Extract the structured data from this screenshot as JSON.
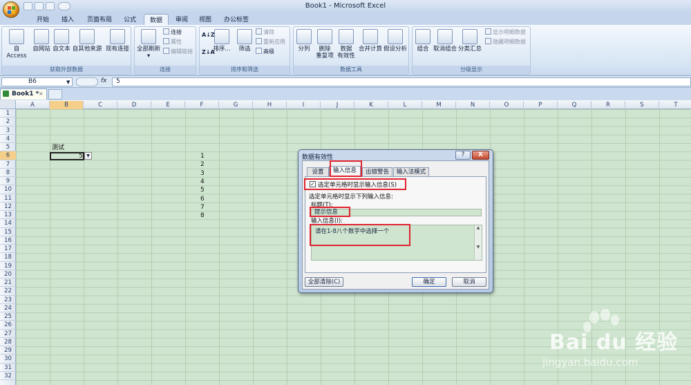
{
  "window": {
    "title": "Book1 - Microsoft Excel"
  },
  "ribbon": {
    "tabs": [
      "开始",
      "插入",
      "页面布局",
      "公式",
      "数据",
      "审阅",
      "视图",
      "办公标签"
    ],
    "active_tab": "数据",
    "groups": {
      "external": {
        "label": "获取外部数据",
        "buttons": [
          "自 Access",
          "自网站",
          "自文本",
          "自其他来源",
          "现有连接"
        ]
      },
      "connections": {
        "label": "连接",
        "refresh_all": "全部刷新",
        "connect": "连接",
        "properties": "属性",
        "edit_links": "编辑链接"
      },
      "sort_filter": {
        "label": "排序和筛选",
        "sort": "排序...",
        "filter": "筛选",
        "clear": "清除",
        "reapply": "重新应用",
        "advanced": "高级"
      },
      "data_tools": {
        "label": "数据工具",
        "text_to_columns": "分列",
        "remove_dup_1": "删除",
        "remove_dup_2": "重复项",
        "validation_1": "数据",
        "validation_2": "有效性",
        "consolidate": "合并计算",
        "whatif": "假设分析"
      },
      "outline": {
        "label": "分级显示",
        "group": "组合",
        "ungroup": "取消组合",
        "subtotal": "分类汇总",
        "show_detail": "显示明细数据",
        "hide_detail": "隐藏明细数据"
      }
    }
  },
  "formula_bar": {
    "name_box": "B6",
    "fx": "fx",
    "value": "5"
  },
  "workbook_tab": {
    "label": "Book1 *",
    "close": "×"
  },
  "sheet": {
    "columns": [
      "A",
      "B",
      "C",
      "D",
      "E",
      "F",
      "G",
      "H",
      "I",
      "J",
      "K",
      "L",
      "M",
      "N",
      "O",
      "P",
      "Q",
      "R",
      "S",
      "T"
    ],
    "selected_column": "B",
    "rows": [
      "1",
      "2",
      "3",
      "4",
      "5",
      "6",
      "7",
      "8",
      "9",
      "10",
      "11",
      "12",
      "13",
      "14",
      "15",
      "16",
      "17",
      "18",
      "19",
      "20",
      "21",
      "22",
      "23",
      "24",
      "25",
      "26",
      "27",
      "28",
      "29",
      "30",
      "31",
      "32"
    ],
    "selected_row": "6",
    "cells": {
      "B5": "测试",
      "B6": "5",
      "F6": "1",
      "F7": "2",
      "F8": "3",
      "F9": "4",
      "F10": "5",
      "F11": "6",
      "F12": "7",
      "F13": "8"
    }
  },
  "dialog": {
    "title": "数据有效性",
    "help": "?",
    "close": "X",
    "tabs": [
      "设置",
      "输入信息",
      "出错警告",
      "输入法模式"
    ],
    "active_tab": "输入信息",
    "show_input_checkbox": {
      "label": "选定单元格时显示输入信息(S)",
      "checked": true,
      "mark": "✓"
    },
    "section_label": "选定单元格时显示下列输入信息:",
    "title_label": "标题(T):",
    "title_value": "提示信息",
    "message_label": "输入信息(I):",
    "message_value": "请在1-8八个数字中选择一个",
    "clear_all": "全部清除(C)",
    "ok": "确定",
    "cancel": "取消"
  },
  "watermark": {
    "brand": "Bai du 经验",
    "url": "jingyan.baidu.com"
  },
  "colors": {
    "grid_bg": "#cfe5cf",
    "highlight": "#e0222e",
    "selected_header": "#f5cf8a"
  }
}
